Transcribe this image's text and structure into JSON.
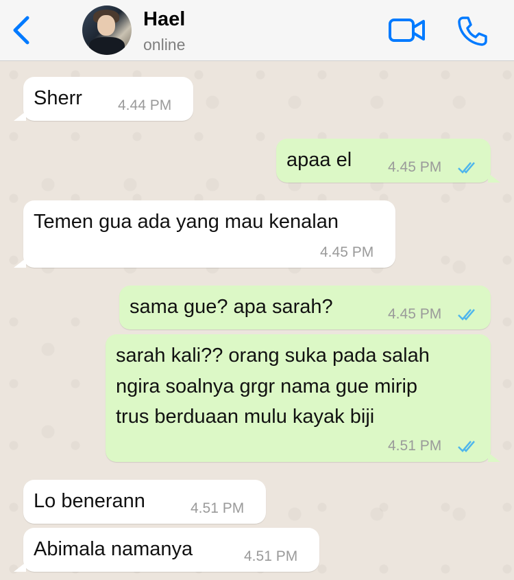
{
  "header": {
    "contact_name": "Hael",
    "status": "online",
    "back_icon": "chevron-left-icon",
    "video_icon": "video-camera-icon",
    "call_icon": "phone-icon",
    "accent_color": "#007aff"
  },
  "messages": [
    {
      "direction": "incoming",
      "text": "Sherr",
      "time": "4.44 PM"
    },
    {
      "direction": "outgoing",
      "text": "apaa el",
      "time": "4.45 PM",
      "status": "read"
    },
    {
      "direction": "incoming",
      "text": "Temen gua ada yang mau kenalan",
      "time": "4.45 PM"
    },
    {
      "direction": "outgoing",
      "text": "sama gue? apa sarah?",
      "time": "4.45 PM",
      "status": "read"
    },
    {
      "direction": "outgoing",
      "lines": [
        "sarah kali?? orang suka pada salah",
        "ngira soalnya grgr nama gue mirip",
        "trus berduaan mulu kayak biji"
      ],
      "time": "4.51 PM",
      "status": "read"
    },
    {
      "direction": "incoming",
      "text": "Lo benerann",
      "time": "4.51 PM"
    },
    {
      "direction": "incoming",
      "text": "Abimala namanya",
      "time": "4.51 PM"
    }
  ],
  "colors": {
    "incoming_bubble": "#ffffff",
    "outgoing_bubble": "#dcf8c6",
    "read_ticks": "#4fb6ec",
    "chat_background": "#ece5dd"
  }
}
